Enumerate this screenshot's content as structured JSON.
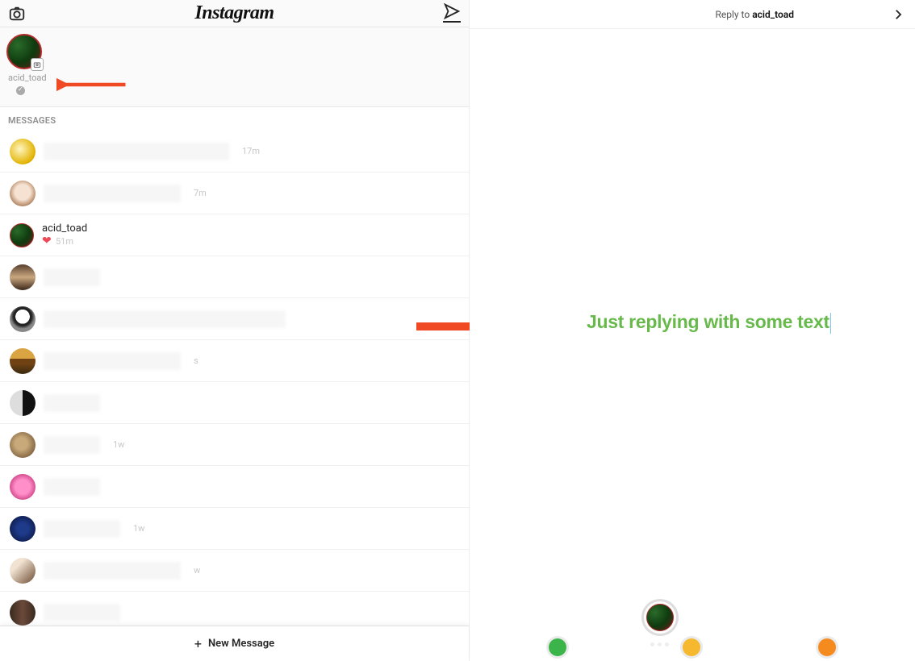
{
  "header": {
    "logo_text": "Instagram"
  },
  "story": {
    "username": "acid_toad"
  },
  "messages_section_label": "MESSAGES",
  "messages": [
    {
      "time": "17m"
    },
    {
      "time": "7m"
    },
    {
      "name": "acid_toad",
      "heart": true,
      "time": "51m"
    },
    {
      "time": ""
    },
    {
      "time": ""
    },
    {
      "time": "s"
    },
    {
      "time": ""
    },
    {
      "time": "1w"
    },
    {
      "time": ""
    },
    {
      "time": "1w"
    },
    {
      "time": "w"
    },
    {
      "time": ""
    }
  ],
  "new_message_label": "New Message",
  "right": {
    "reply_prefix": "Reply to ",
    "reply_user": "acid_toad",
    "typed_text": "Just replying with some text"
  },
  "colors": {
    "annotation_red": "#f04a24",
    "reply_green": "#68b94b"
  }
}
